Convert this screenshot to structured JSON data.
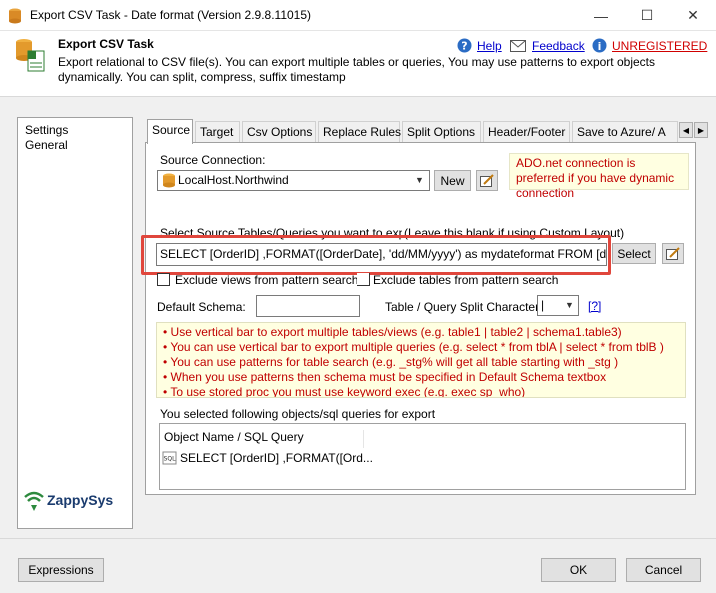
{
  "window": {
    "title": "Export CSV Task - Date format (Version 2.9.8.11015)",
    "minimize_glyph": "—",
    "maximize_glyph": "☐",
    "close_glyph": "✕"
  },
  "header": {
    "title": "Export CSV Task",
    "description": "Export relational to CSV file(s). You can export multiple tables or queries, You may use patterns to export objects dynamically. You can split, compress, suffix timestamp",
    "help_label": "Help",
    "feedback_label": "Feedback",
    "unregistered_label": "UNREGISTERED"
  },
  "sidebar": {
    "items": [
      {
        "label": "Settings"
      },
      {
        "label": "General"
      }
    ],
    "logo_text": "ZappySys"
  },
  "tabs": [
    {
      "label": "Source"
    },
    {
      "label": "Target"
    },
    {
      "label": "Csv Options"
    },
    {
      "label": "Replace Rules"
    },
    {
      "label": "Split Options"
    },
    {
      "label": "Header/Footer"
    },
    {
      "label": "Save to Azure/ A"
    }
  ],
  "source": {
    "connection_label": "Source Connection:",
    "connection_value": "LocalHost.Northwind",
    "new_button": "New",
    "ado_note": "ADO.net connection is preferred if you have dynamic connection",
    "select_label": "Select Source Tables/Queries you want to expo",
    "select_hint": "(Leave this blank if using Custom Layout)",
    "query_value": "SELECT [OrderID] ,FORMAT([OrderDate], 'dd/MM/yyyy') as mydateformat   FROM [d",
    "select_button": "Select",
    "exclude_views": "Exclude views from pattern search",
    "exclude_tables": "Exclude tables from pattern search",
    "default_schema_label": "Default Schema:",
    "default_schema_value": "",
    "split_char_label": "Table / Query Split Character:",
    "split_char_value": "|",
    "help_q": "[?]",
    "notes": [
      "• Use vertical bar to export multiple tables/views (e.g. table1 | table2 | schema1.table3)",
      "• You can use vertical bar to export multiple queries (e.g. select * from tblA | select * from tblB )",
      "• You can use patterns for table search (e.g. _stg% will get all table starting with _stg )",
      "• When you use patterns then schema must be specified in Default Schema textbox",
      "• To use stored proc you must use keyword exec (e.g. exec sp_who)"
    ],
    "selected_label": "You selected following objects/sql queries for export",
    "list_header": "Object Name / SQL Query",
    "list_items": [
      {
        "label": "SELECT [OrderID] ,FORMAT([Ord..."
      }
    ]
  },
  "footer": {
    "expressions_button": "Expressions",
    "ok_button": "OK",
    "cancel_button": "Cancel"
  },
  "colors": {
    "highlight_border": "#e0463c",
    "unregistered": "#d00000",
    "note_text": "#c00000",
    "note_bg": "#ffffe1",
    "link": "#0000cc"
  }
}
